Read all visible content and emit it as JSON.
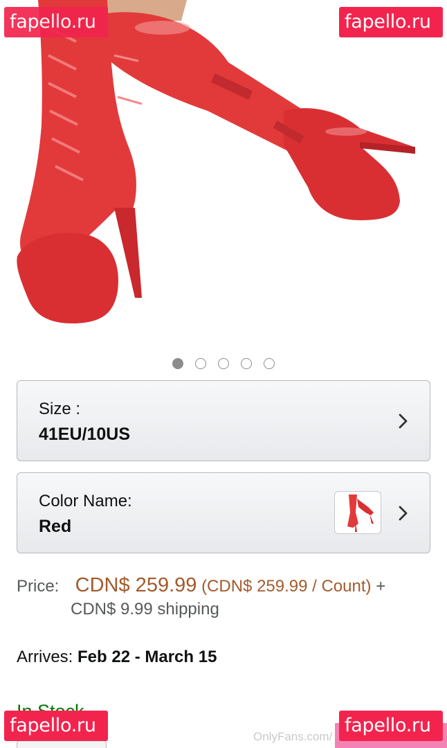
{
  "watermark": {
    "text": "fapello.ru",
    "color": "#f2244e"
  },
  "carousel": {
    "count": 5,
    "active_index": 0
  },
  "size_option": {
    "label": "Size :",
    "value": "41EU/10US"
  },
  "color_option": {
    "label": "Color Name:",
    "value": "Red"
  },
  "price": {
    "label": "Price:",
    "amount": "CDN$ 259.99",
    "unit_price": "(CDN$ 259.99 / Count)",
    "plus": "+",
    "shipping": "CDN$ 9.99 shipping"
  },
  "delivery": {
    "label": "Arrives:",
    "dates": "Feb 22 - March 15"
  },
  "stock": {
    "status": "In Stock."
  },
  "onlyfans_watermark": "OnlyFans.com/",
  "colors": {
    "price": "#a35a2c",
    "stock": "#007600",
    "product_red": "#e53a3a"
  },
  "icons": {
    "chevron": "chevron-right-icon"
  }
}
